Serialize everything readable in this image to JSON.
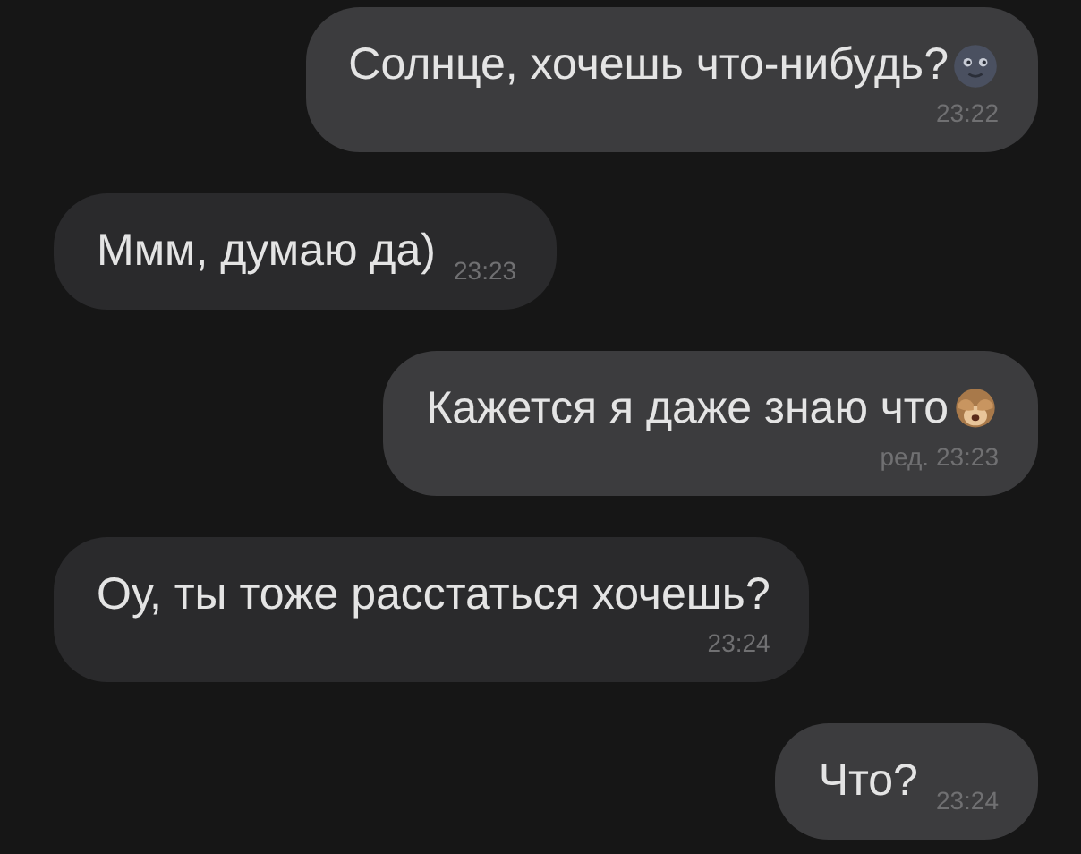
{
  "messages": [
    {
      "outgoing": true,
      "kind": "stacked",
      "text": "Солнце, хочешь что-нибудь?",
      "emoji": {
        "kind": "moon"
      },
      "time": "23:22"
    },
    {
      "outgoing": false,
      "kind": "inline",
      "text": "Ммм, думаю да)",
      "time": "23:23"
    },
    {
      "outgoing": true,
      "kind": "stacked",
      "text": "Кажется я даже знаю что",
      "emoji": {
        "kind": "monkey"
      },
      "time": "ред. 23:23"
    },
    {
      "outgoing": false,
      "kind": "stacked",
      "text": "Оу, ты тоже расстаться хочешь?",
      "time": "23:24"
    },
    {
      "outgoing": true,
      "kind": "inline",
      "text": "Что?",
      "time": "23:24"
    }
  ]
}
